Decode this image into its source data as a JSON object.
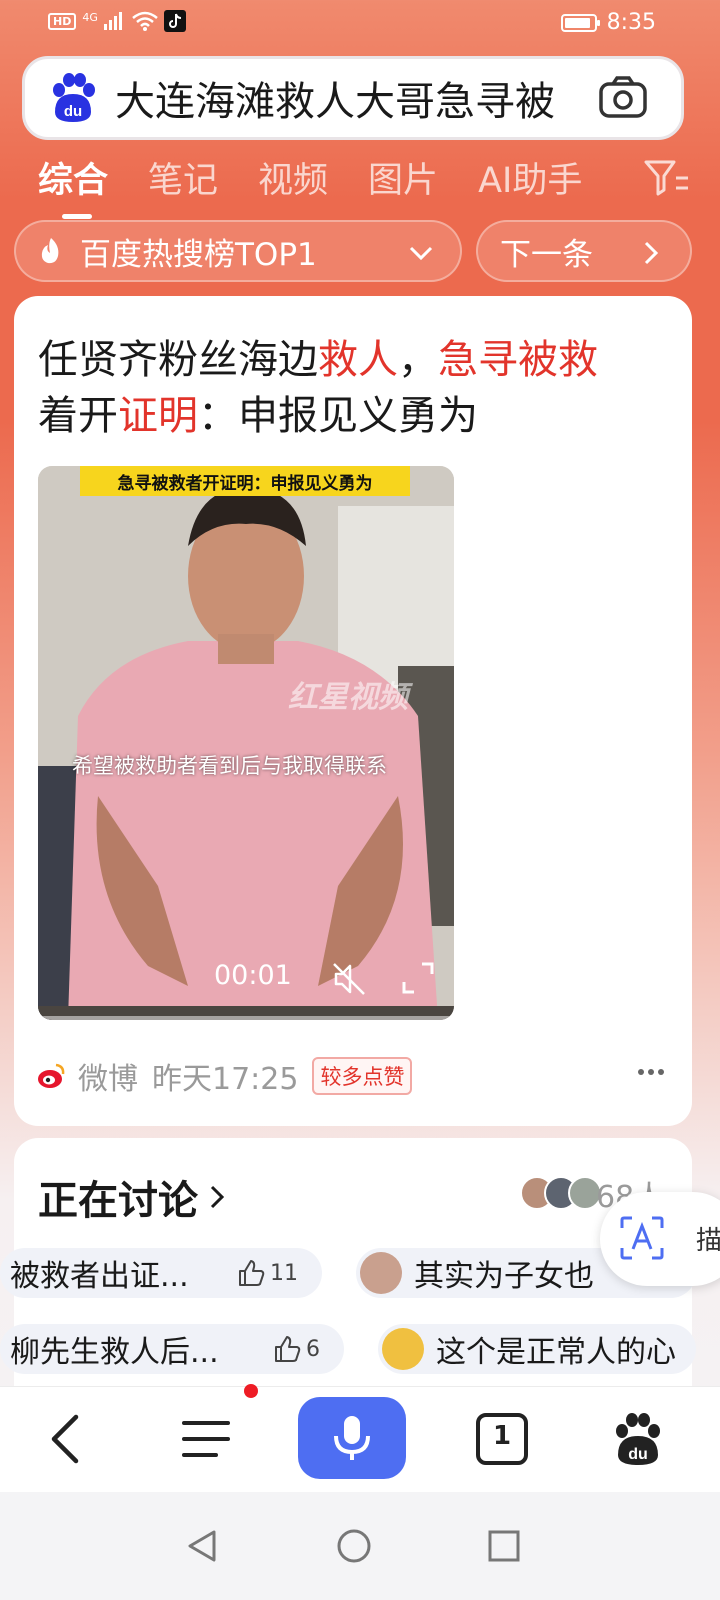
{
  "status_bar": {
    "network": "HD",
    "signal": "4G",
    "time": "8:35",
    "battery_level": 0.9
  },
  "search": {
    "query": "大连海滩救人大哥急寻被",
    "logo_icon": "baidu-paw-icon",
    "camera_icon": "camera-icon"
  },
  "tabs": [
    {
      "label": "综合",
      "active": true
    },
    {
      "label": "笔记",
      "active": false
    },
    {
      "label": "视频",
      "active": false
    },
    {
      "label": "图片",
      "active": false
    },
    {
      "label": "AI助手",
      "active": false
    }
  ],
  "hot": {
    "label": "百度热搜榜TOP1",
    "next_label": "下一条"
  },
  "article": {
    "title_parts": [
      "任贤齐粉丝海边",
      "救人",
      "，",
      "急寻被救",
      "着开",
      "证明",
      "：申报见义勇为"
    ],
    "video": {
      "banner": "急寻被救者开证明：申报见义勇为",
      "caption": "希望被救助者看到后与我取得联系",
      "watermark": "红星视频",
      "time": "00:01"
    },
    "source": "微博",
    "time": "昨天17:25",
    "badge": "较多点赞"
  },
  "discussion": {
    "title": "正在讨论",
    "count": "68人",
    "comments_row1": [
      {
        "text": "被救者出证...",
        "likes": "11"
      },
      {
        "text": "其实为子女也"
      }
    ],
    "comments_row2": [
      {
        "text": "柳先生救人后...",
        "likes": "6"
      },
      {
        "text": "这个是正常人的心"
      }
    ]
  },
  "float_button": {
    "icon": "text-recognition-icon",
    "edge_text": "描"
  },
  "toolbar": {
    "tab_count": "1"
  },
  "colors": {
    "accent_red": "#e2342b",
    "baidu_blue": "#4e6ef2",
    "header_bg": "#ec6a4e"
  }
}
